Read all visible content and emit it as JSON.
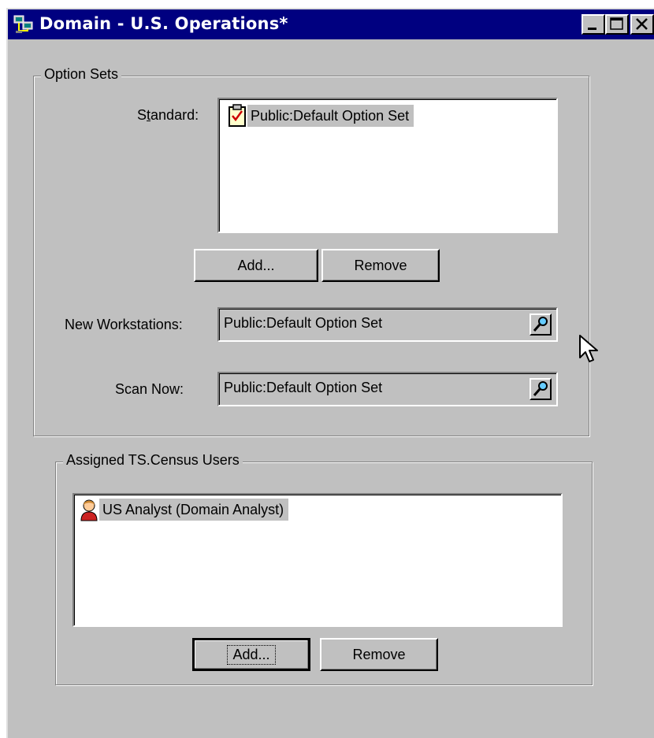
{
  "window": {
    "title": "Domain - U.S. Operations*",
    "title_icon": "network-computers-icon",
    "controls": [
      "minimize-icon",
      "maximize-icon",
      "close-icon"
    ]
  },
  "option_sets": {
    "legend": "Option Sets",
    "standard_label": "Standard:",
    "standard_items": [
      {
        "label": "Public:Default Option Set",
        "icon": "checklist-clipboard-icon"
      }
    ],
    "add_label": "Add...",
    "remove_label": "Remove",
    "new_workstations_label": "New Workstations:",
    "new_workstations_value": "Public:Default Option Set",
    "scan_now_label": "Scan Now:",
    "scan_now_value": "Public:Default Option Set",
    "lookup_icon": "magnifier-icon"
  },
  "assigned_users": {
    "legend": "Assigned TS.Census Users",
    "items": [
      {
        "label": "US Analyst (Domain Analyst)",
        "icon": "user-person-icon"
      }
    ],
    "add_label": "Add...",
    "remove_label": "Remove"
  },
  "colors": {
    "titlebar": "#000080",
    "face": "#c0c0c0",
    "selection": "#c0c0c0"
  }
}
